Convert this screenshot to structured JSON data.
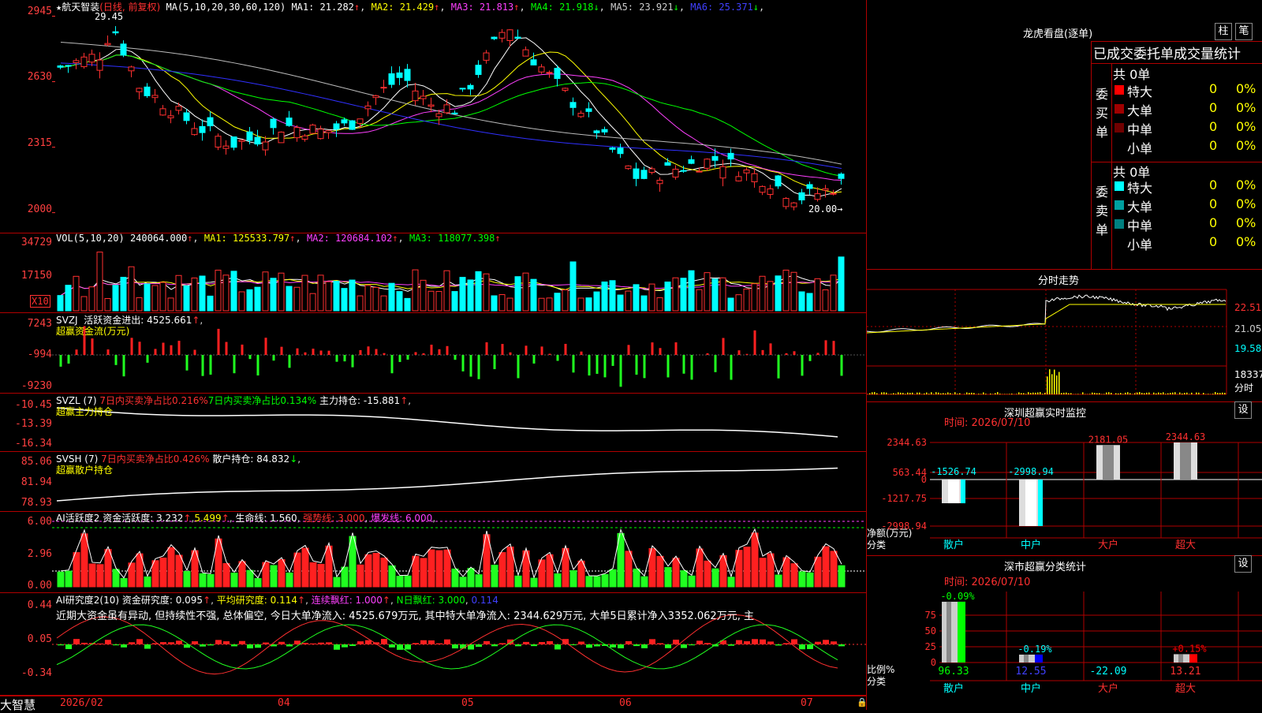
{
  "stock": {
    "name": "航天智装",
    "mode": "(日线, 前复权)"
  },
  "main": {
    "ma_label": "MA(5,10,20,30,60,120)",
    "ma": [
      {
        "label": "MA1: 21.282",
        "arrow": "↑",
        "color": "#ffffff"
      },
      {
        "label": "MA2: 21.429",
        "arrow": "↑",
        "color": "#ffff00"
      },
      {
        "label": "MA3: 21.813",
        "arrow": "↑",
        "color": "#ff40ff"
      },
      {
        "label": "MA4: 21.918",
        "arrow": "↓",
        "color": "#00ff00"
      },
      {
        "label": "MA5: 23.921",
        "arrow": "↓",
        "color": "#cccccc"
      },
      {
        "label": "MA6: 25.371",
        "arrow": "↓",
        "color": "#4040ff"
      }
    ],
    "axis": [
      "2945",
      "2630",
      "2315",
      "2000"
    ],
    "high_mark": "29.45",
    "low_mark": "20.00"
  },
  "vol": {
    "title": "VOL(5,10,20)",
    "value": "240064.000",
    "ma1": "MA1: 125533.797",
    "ma2": "MA2: 120684.102",
    "ma3": "MA3: 118077.398",
    "axis": [
      "34729",
      "17150"
    ],
    "unit": "X10"
  },
  "svzj": {
    "title": "SVZJ",
    "label": "活跃资金进出: 4525.661",
    "sub": "超赢资金流(万元)",
    "axis": [
      "7243",
      "-994",
      "-9230"
    ]
  },
  "svzl": {
    "title": "SVZL (7)",
    "r1": "7日内买卖净占比0.216%",
    "r2": "7日内买卖净占比0.134%",
    "r3": "主力持仓: -15.881",
    "sub": "超赢主力持仓",
    "axis": [
      "-10.45",
      "-13.39",
      "-16.34"
    ]
  },
  "svsh": {
    "title": "SVSH (7)",
    "r1": "7日内买卖净占比0.426%",
    "r2": "散户持仓: 84.832",
    "sub": "超赢散户持仓",
    "axis": [
      "85.06",
      "81.94",
      "78.93"
    ]
  },
  "ai1": {
    "title": "AI活跃度2",
    "a": "资金活跃度: 3.232",
    "b": "5.499",
    "c": "生命线: 1.560",
    "d": "强势线: 3.000",
    "e": "爆发线: 6.000",
    "axis": [
      "6.00",
      "2.96",
      "0.00"
    ]
  },
  "ai2": {
    "title": "AI研究度2(10)",
    "a": "资金研究度: 0.095",
    "b": "平均研究度: 0.114",
    "c": "连续飘红: 1.000",
    "d": "N日飘红: 3.000",
    "e": "0.114",
    "text": "近期大资金虽有异动, 但持续性不强, 总体偏空, 今日大单净流入: 4525.679万元, 其中特大单净流入: 2344.629万元, 大单5日累计净入3352.062万元, 主",
    "axis": [
      "0.44",
      "0.05",
      "-0.34"
    ]
  },
  "dates": {
    "brand": "大智慧",
    "labels": [
      "2026/02",
      "04",
      "05",
      "06",
      "07"
    ]
  },
  "dragon": {
    "title": "龙虎看盘(逐单)",
    "btn1": "柱",
    "btn2": "笔",
    "header": "已成交委托单成交量统计",
    "buy_label": "委买单",
    "sell_label": "委卖单",
    "buy_total": "共 0单",
    "sell_total": "共 0单",
    "buy_rows": [
      {
        "name": "特大",
        "count": "0",
        "pct": "0%",
        "color": "#ff0000"
      },
      {
        "name": "大单",
        "count": "0",
        "pct": "0%",
        "color": "#a00000"
      },
      {
        "name": "中单",
        "count": "0",
        "pct": "0%",
        "color": "#700000"
      },
      {
        "name": "小单",
        "count": "0",
        "pct": "0%",
        "color": ""
      }
    ],
    "sell_rows": [
      {
        "name": "特大",
        "count": "0",
        "pct": "0%",
        "color": "#00ffff"
      },
      {
        "name": "大单",
        "count": "0",
        "pct": "0%",
        "color": "#00a0a0"
      },
      {
        "name": "中单",
        "count": "0",
        "pct": "0%",
        "color": "#008080"
      },
      {
        "name": "小单",
        "count": "0",
        "pct": "0%",
        "color": ""
      }
    ]
  },
  "intraday": {
    "title": "分时走势",
    "axis": [
      "22.51",
      "21.05",
      "19.58"
    ],
    "vol_axis": "18337",
    "vol_unit": "分时"
  },
  "monitor": {
    "title": "深圳超赢实时监控",
    "btn": "设",
    "time": "时间: 2026/07/10",
    "axis": [
      "2344.63",
      "563.44",
      "0",
      "-1217.75",
      "-2998.94"
    ],
    "ylabel": "净额(万元)",
    "xlabel": "分类",
    "cats": [
      "散户",
      "中户",
      "大户",
      "超大"
    ]
  },
  "classify": {
    "title": "深市超赢分类统计",
    "btn": "设",
    "time": "时间: 2026/07/10",
    "axis": [
      "75",
      "50",
      "25",
      "0"
    ],
    "ylabel": "比例%",
    "xlabel": "分类",
    "cats": [
      "散户",
      "中户",
      "大户",
      "超大"
    ]
  },
  "chart_data": [
    {
      "type": "bar",
      "title": "深圳超赢实时监控",
      "categories": [
        "散户",
        "中户",
        "大户",
        "超大"
      ],
      "values": [
        -1526.74,
        -2998.94,
        2181.05,
        2344.63
      ],
      "ylabel": "净额(万元)",
      "ylim": [
        -2998.94,
        2344.63
      ]
    },
    {
      "type": "bar",
      "title": "深市超赢分类统计",
      "categories": [
        "散户",
        "中户",
        "大户",
        "超大"
      ],
      "values": [
        96.33,
        12.55,
        -22.09,
        13.21
      ],
      "changes": [
        "-0.09%",
        "-0.19%",
        "",
        "+0.15%"
      ],
      "ylabel": "比例%",
      "ylim": [
        0,
        100
      ]
    }
  ]
}
